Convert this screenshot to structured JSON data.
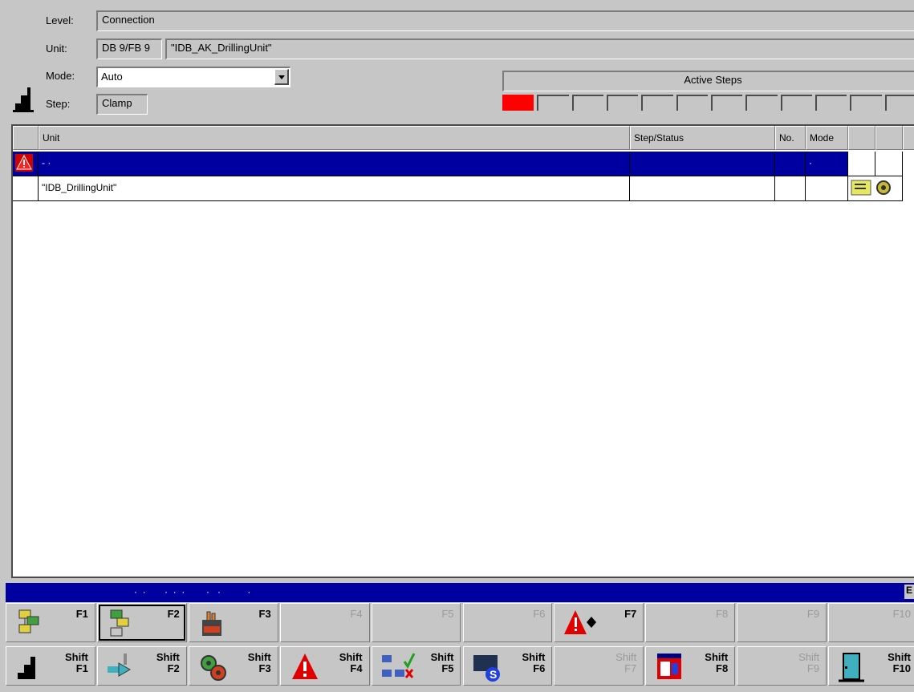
{
  "header": {
    "level_label": "Level:",
    "level_value": "Connection",
    "unit_label": "Unit:",
    "unit_db": "DB 9/FB 9",
    "unit_name": "\"IDB_AK_DrillingUnit\"",
    "mode_label": "Mode:",
    "mode_value": "Auto",
    "step_label": "Step:",
    "step_value": "Clamp"
  },
  "active_steps": {
    "title": "Active Steps",
    "count": 12,
    "active_index": 0,
    "active_color": "#ff0000"
  },
  "table": {
    "columns": [
      "Unit",
      "Step/Status",
      "No.",
      "Mode"
    ],
    "rows": [
      {
        "unit": "  -  ·",
        "step_status": "",
        "no": "",
        "mode": "·",
        "selected": true,
        "icon": "alarm-icon"
      },
      {
        "unit": "\"IDB_DrillingUnit\"",
        "step_status": "",
        "no": "",
        "mode": "",
        "selected": false,
        "icon": "unit-status-icon"
      }
    ]
  },
  "status_bar": {
    "text": "·  ·       ·  ·  ·        ·   ·          ·",
    "right_glyph": "E"
  },
  "fkeys_top": [
    {
      "label": "F1",
      "icon": "overview-icon",
      "enabled": true
    },
    {
      "label": "F2",
      "icon": "unit-select-icon",
      "enabled": true,
      "selected": true
    },
    {
      "label": "F3",
      "icon": "manual-hand-icon",
      "enabled": true
    },
    {
      "label": "F4",
      "icon": "",
      "enabled": false
    },
    {
      "label": "F5",
      "icon": "",
      "enabled": false
    },
    {
      "label": "F6",
      "icon": "",
      "enabled": false
    },
    {
      "label": "F7",
      "icon": "alarm-navigate-icon",
      "enabled": true
    },
    {
      "label": "F8",
      "icon": "",
      "enabled": false
    },
    {
      "label": "F9",
      "icon": "",
      "enabled": false
    },
    {
      "label": "F10",
      "icon": "",
      "enabled": false
    }
  ],
  "fkeys_bottom": [
    {
      "shift": "Shift",
      "label": "F1",
      "icon": "mode-icon",
      "enabled": true
    },
    {
      "shift": "Shift",
      "label": "F2",
      "icon": "valve-icon",
      "enabled": true
    },
    {
      "shift": "Shift",
      "label": "F3",
      "icon": "gears-icon",
      "enabled": true
    },
    {
      "shift": "Shift",
      "label": "F4",
      "icon": "alarm-icon",
      "enabled": true
    },
    {
      "shift": "Shift",
      "label": "F5",
      "icon": "network-check-icon",
      "enabled": true
    },
    {
      "shift": "Shift",
      "label": "F6",
      "icon": "s-badge-icon",
      "enabled": true
    },
    {
      "shift": "Shift",
      "label": "F7",
      "icon": "",
      "enabled": false
    },
    {
      "shift": "Shift",
      "label": "F8",
      "icon": "windows-icon",
      "enabled": true
    },
    {
      "shift": "Shift",
      "label": "F9",
      "icon": "",
      "enabled": false
    },
    {
      "shift": "Shift",
      "label": "F10",
      "icon": "exit-door-icon",
      "enabled": true
    }
  ]
}
